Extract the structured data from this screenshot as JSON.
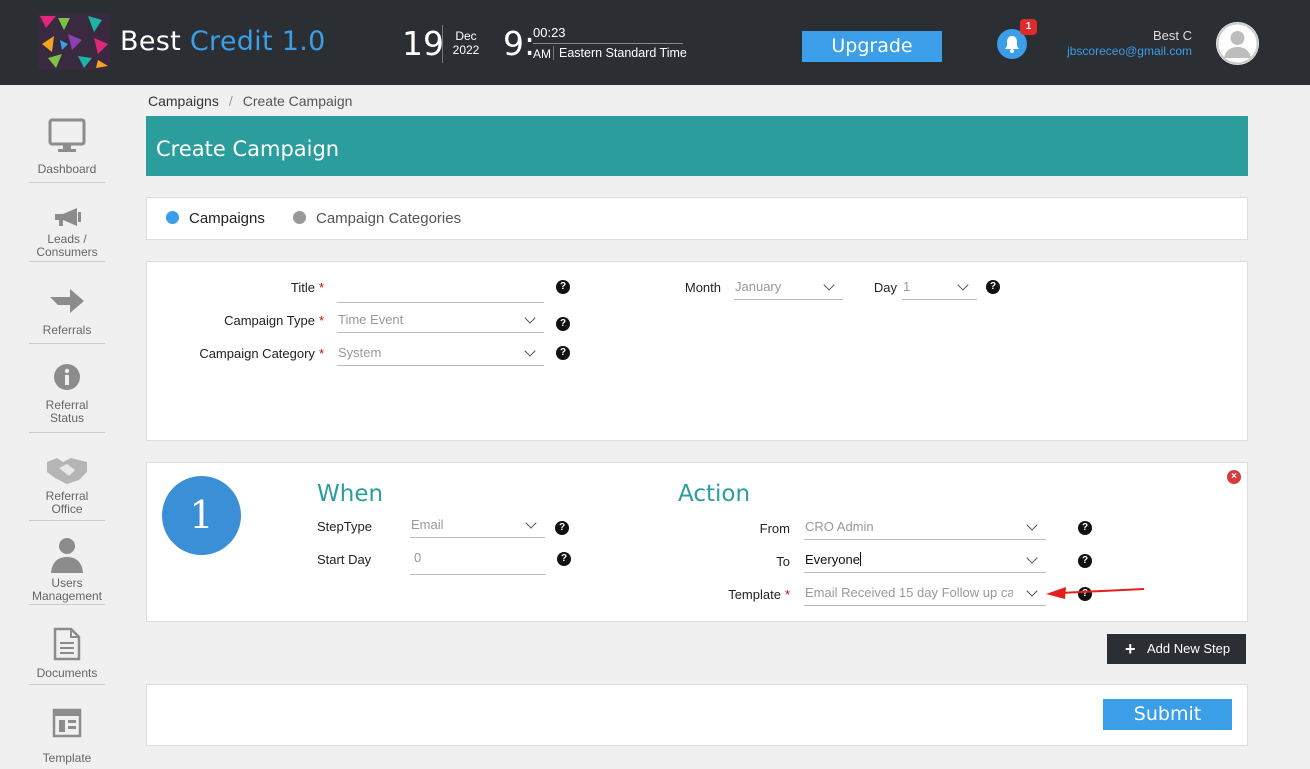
{
  "header": {
    "brand_main": "Best ",
    "brand_accent": "Credit 1.0",
    "date_day": "19",
    "date_month": "Dec",
    "date_year": "2022",
    "time_hour": "9:",
    "time_minutes": "00:23",
    "time_ampm": "AM",
    "time_zone": "Eastern Standard Time",
    "upgrade_label": "Upgrade",
    "notification_count": "1",
    "user_name": "Best C",
    "user_email": "jbscoreceo@gmail.com"
  },
  "sidebar": {
    "items": [
      {
        "label": "Dashboard",
        "icon": "monitor-icon"
      },
      {
        "label": "Leads /\nConsumers",
        "icon": "megaphone-icon"
      },
      {
        "label": "Referrals",
        "icon": "arrow-icon"
      },
      {
        "label": "Referral\nStatus",
        "icon": "info-icon"
      },
      {
        "label": "Referral\nOffice",
        "icon": "handshake-icon"
      },
      {
        "label": "Users\nManagement",
        "icon": "user-icon"
      },
      {
        "label": "Documents",
        "icon": "document-icon"
      },
      {
        "label": "Template",
        "icon": "template-icon"
      }
    ]
  },
  "breadcrumb": {
    "root": "Campaigns",
    "separator": "/",
    "current": "Create Campaign"
  },
  "page_title": "Create Campaign",
  "tabs": [
    {
      "label": "Campaigns",
      "active": true
    },
    {
      "label": "Campaign Categories",
      "active": false
    }
  ],
  "campaign_form": {
    "title_label": "Title",
    "title_value": "",
    "type_label": "Campaign Type",
    "type_value": "Time Event",
    "category_label": "Campaign Category",
    "category_value": "System",
    "month_label": "Month",
    "month_value": "January",
    "day_label": "Day",
    "day_value": "1",
    "required_mark": "*",
    "help_glyph": "?"
  },
  "step": {
    "number": "1",
    "when_heading": "When",
    "action_heading": "Action",
    "steptype_label": "StepType",
    "steptype_value": "Email",
    "startday_label": "Start Day",
    "startday_placeholder": "0",
    "from_label": "From",
    "from_value": "CRO Admin",
    "to_label": "To",
    "to_value": "Everyone",
    "template_label": "Template",
    "template_value": "Email Received 15 day Follow up ca"
  },
  "buttons": {
    "add_step": "Add New Step",
    "add_step_glyph": "+",
    "submit": "Submit",
    "remove_glyph": "×"
  },
  "colors": {
    "header_bg": "#2b2e33",
    "accent_blue": "#3a9ee8",
    "teal": "#2a9d9c",
    "required_red": "#dd0000"
  }
}
